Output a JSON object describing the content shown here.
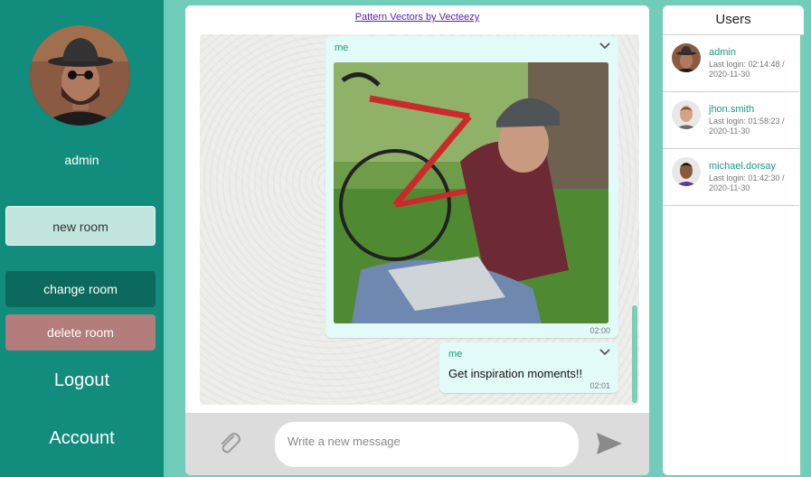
{
  "sidebar": {
    "username": "admin",
    "new_room": "new room",
    "change_room": "change room",
    "delete_room": "delete room",
    "logout": "Logout",
    "account": "Account"
  },
  "chat": {
    "credit_link": "Pattern Vectors by Vecteezy",
    "messages": [
      {
        "sender": "me",
        "type": "image",
        "time": "02:00"
      },
      {
        "sender": "me",
        "type": "text",
        "text": "Get inspiration moments!!",
        "time": "02:01"
      }
    ],
    "composer": {
      "placeholder": "Write a new message"
    }
  },
  "users_panel": {
    "title": "Users",
    "users": [
      {
        "name": "admin",
        "last_login": "Last login: 02:14:48 / 2020-11-30"
      },
      {
        "name": "jhon.smith",
        "last_login": "Last login: 01:58:23 / 2020-11-30"
      },
      {
        "name": "michael.dorsay",
        "last_login": "Last login: 01:42:30 / 2020-11-30"
      }
    ]
  },
  "colors": {
    "sidebar_bg": "#128c7c",
    "page_bg": "#71ccb9",
    "bubble_bg": "#e2fbf8",
    "accent_text": "#1a9a83",
    "delete_button": "#b27d7b"
  },
  "icons": [
    "paperclip-icon",
    "send-icon",
    "chevron-down-icon"
  ]
}
